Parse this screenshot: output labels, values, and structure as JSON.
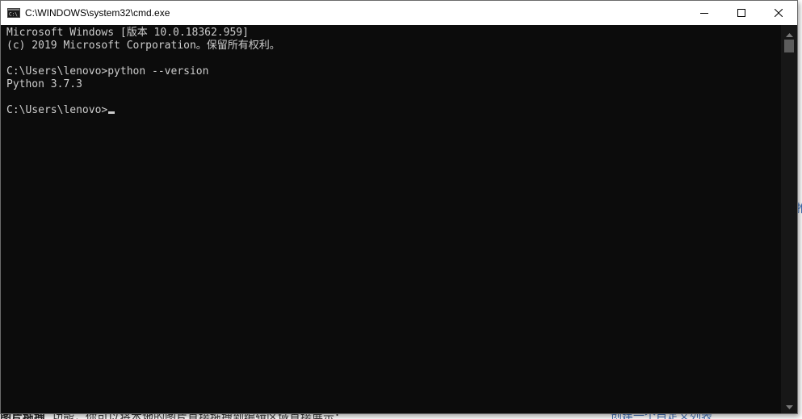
{
  "window": {
    "title": "C:\\WINDOWS\\system32\\cmd.exe",
    "icon": "cmd-icon",
    "controls": {
      "minimize": "minimize-icon",
      "maximize": "maximize-icon",
      "close": "close-icon"
    }
  },
  "console": {
    "lines": [
      "Microsoft Windows [版本 10.0.18362.959]",
      "(c) 2019 Microsoft Corporation。保留所有权利。",
      "",
      "C:\\Users\\lenovo>python --version",
      "Python 3.7.3",
      "",
      "C:\\Users\\lenovo>"
    ]
  },
  "background_page": {
    "fragments": [
      {
        "text": "言"
      },
      {
        "text": "事"
      },
      {
        "text": "耳"
      },
      {
        "text": "d"
      },
      {
        "text": "所"
      },
      {
        "text": "用"
      },
      {
        "text": "心"
      },
      {
        "text": "图片拖拽"
      },
      {
        "text": "功能，你可以将本地的图片直接拖拽到编辑区域直接展示；"
      },
      {
        "text": "创建一个自定义列表"
      },
      {
        "text": "推"
      }
    ]
  },
  "colors": {
    "console_bg": "#0c0c0c",
    "console_text": "#cccccc",
    "titlebar_bg": "#ffffff",
    "link": "#3f6fb5"
  }
}
